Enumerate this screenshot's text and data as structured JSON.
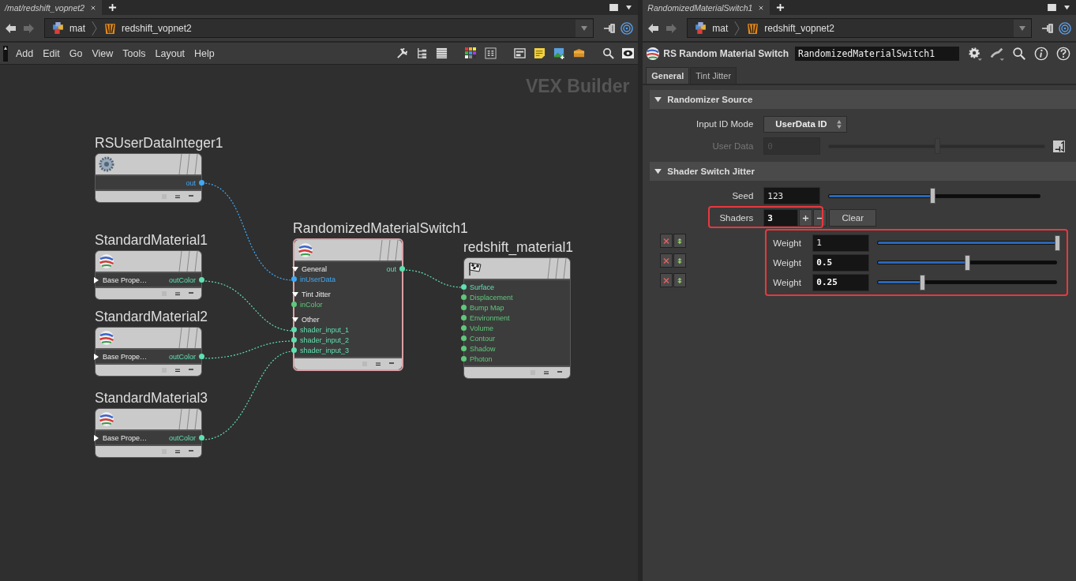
{
  "network_pane": {
    "tab": {
      "title": "/mat/redshift_vopnet2"
    },
    "path": [
      "mat",
      "redshift_vopnet2"
    ],
    "menu": [
      "Add",
      "Edit",
      "Go",
      "View",
      "Tools",
      "Layout",
      "Help"
    ],
    "context_label": "VEX Builder",
    "nodes": [
      {
        "name": "RSUserDataInteger1",
        "selected": false,
        "outputs": [
          {
            "name": "out",
            "color": "#3fa9f5"
          }
        ]
      },
      {
        "name": "StandardMaterial1",
        "selected": false,
        "groups": [
          {
            "label": "Base Prope…",
            "expanded": false
          }
        ],
        "outputs": [
          {
            "name": "outColor",
            "color": "#5ee0b0"
          }
        ]
      },
      {
        "name": "StandardMaterial2",
        "selected": false,
        "groups": [
          {
            "label": "Base Prope…",
            "expanded": false
          }
        ],
        "outputs": [
          {
            "name": "outColor",
            "color": "#5ee0b0"
          }
        ]
      },
      {
        "name": "StandardMaterial3",
        "selected": false,
        "groups": [
          {
            "label": "Base Prope…",
            "expanded": false
          }
        ],
        "outputs": [
          {
            "name": "outColor",
            "color": "#5ee0b0"
          }
        ]
      },
      {
        "name": "RandomizedMaterialSwitch1",
        "selected": true,
        "groups": [
          {
            "label": "General",
            "expanded": true,
            "inputs": [
              {
                "name": "inUserData",
                "color": "#3fa9f5"
              }
            ]
          },
          {
            "label": "Tint Jitter",
            "expanded": true,
            "inputs": [
              {
                "name": "inColor",
                "color": "#5fc87a"
              }
            ]
          },
          {
            "label": "Other",
            "expanded": true,
            "inputs": [
              {
                "name": "shader_input_1",
                "color": "#5ee0b0"
              },
              {
                "name": "shader_input_2",
                "color": "#5ee0b0"
              },
              {
                "name": "shader_input_3",
                "color": "#5ee0b0"
              }
            ]
          }
        ],
        "outputs": [
          {
            "name": "out",
            "color": "#5ee0b0"
          }
        ]
      },
      {
        "name": "redshift_material1",
        "selected": false,
        "inputs": [
          {
            "name": "Surface",
            "color": "#5ee0b0"
          },
          {
            "name": "Displacement",
            "color": "#5fc87a"
          },
          {
            "name": "Bump Map",
            "color": "#5fc87a"
          },
          {
            "name": "Environment",
            "color": "#5fc87a"
          },
          {
            "name": "Volume",
            "color": "#5fc87a"
          },
          {
            "name": "Contour",
            "color": "#5fc87a"
          },
          {
            "name": "Shadow",
            "color": "#5fc87a"
          },
          {
            "name": "Photon",
            "color": "#5fc87a"
          }
        ]
      }
    ]
  },
  "parameter_pane": {
    "tab": {
      "title": "RandomizedMaterialSwitch1"
    },
    "path": [
      "mat",
      "redshift_vopnet2"
    ],
    "node_type": "RS Random Material Switch",
    "node_name": "RandomizedMaterialSwitch1",
    "tabs": [
      {
        "label": "General",
        "selected": true
      },
      {
        "label": "Tint Jitter",
        "selected": false
      }
    ],
    "sections": [
      {
        "title": "Randomizer Source",
        "expanded": true,
        "params": [
          {
            "kind": "menu",
            "label": "Input ID Mode",
            "value": "UserData ID"
          },
          {
            "kind": "slider",
            "label": "User Data",
            "value": "0",
            "level": 0.5,
            "disabled": true,
            "modified": false,
            "link_button": true
          }
        ]
      },
      {
        "title": "Shader Switch Jitter",
        "expanded": true,
        "params": [
          {
            "kind": "slider",
            "label": "Seed",
            "value": "123",
            "level": 0.49,
            "disabled": false,
            "modified": false
          },
          {
            "kind": "multiparm",
            "label": "Shaders",
            "value": "3",
            "modified": true,
            "highlighted": true,
            "clear_label": "Clear",
            "instances_highlighted": true,
            "instances": [
              {
                "label": "Weight",
                "value": "1",
                "level": 1,
                "modified": false
              },
              {
                "label": "Weight",
                "value": "0.5",
                "level": 0.5,
                "modified": true
              },
              {
                "label": "Weight",
                "value": "0.25",
                "level": 0.25,
                "modified": true
              }
            ]
          }
        ]
      }
    ]
  }
}
